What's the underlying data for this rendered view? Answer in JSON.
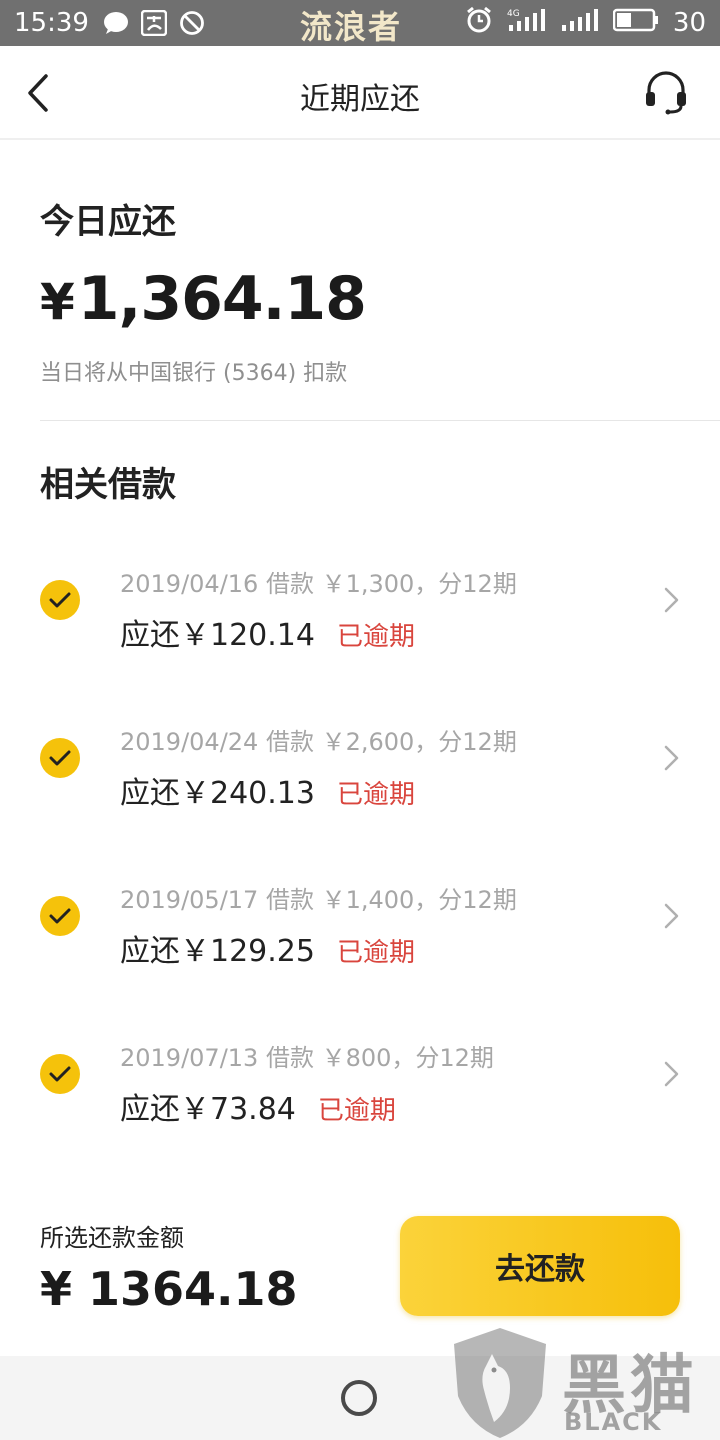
{
  "status_bar": {
    "time": "15:39",
    "center_text": "流浪者",
    "battery": "30",
    "icons": [
      "message-icon",
      "pay-icon",
      "block-icon",
      "alarm-icon",
      "signal-4g-icon",
      "signal-icon",
      "battery-icon"
    ]
  },
  "nav": {
    "title": "近期应还",
    "back_icon": "chevron-left-icon",
    "support_icon": "headset-icon"
  },
  "today": {
    "label": "今日应还",
    "currency": "¥",
    "amount": "1,364.18",
    "note": "当日将从中国银行 (5364) 扣款"
  },
  "related": {
    "title": "相关借款",
    "loans": [
      {
        "info": "2019/04/16 借款 ￥1,300，分12期",
        "due": "应还￥120.14",
        "status": "已逾期"
      },
      {
        "info": "2019/04/24 借款 ￥2,600，分12期",
        "due": "应还￥240.13",
        "status": "已逾期"
      },
      {
        "info": "2019/05/17 借款 ￥1,400，分12期",
        "due": "应还￥129.25",
        "status": "已逾期"
      },
      {
        "info": "2019/07/13 借款 ￥800，分12期",
        "due": "应还￥73.84",
        "status": "已逾期"
      }
    ]
  },
  "footer": {
    "selected_label": "所选还款金额",
    "selected_amount": "¥ 1364.18",
    "pay_button": "去还款"
  },
  "watermark": {
    "cn": "黑猫",
    "en": "BLACK CAT"
  },
  "colors": {
    "accent_yellow": "#f6bf0a",
    "overdue_red": "#d9453d",
    "status_bar_gray": "#707070"
  }
}
